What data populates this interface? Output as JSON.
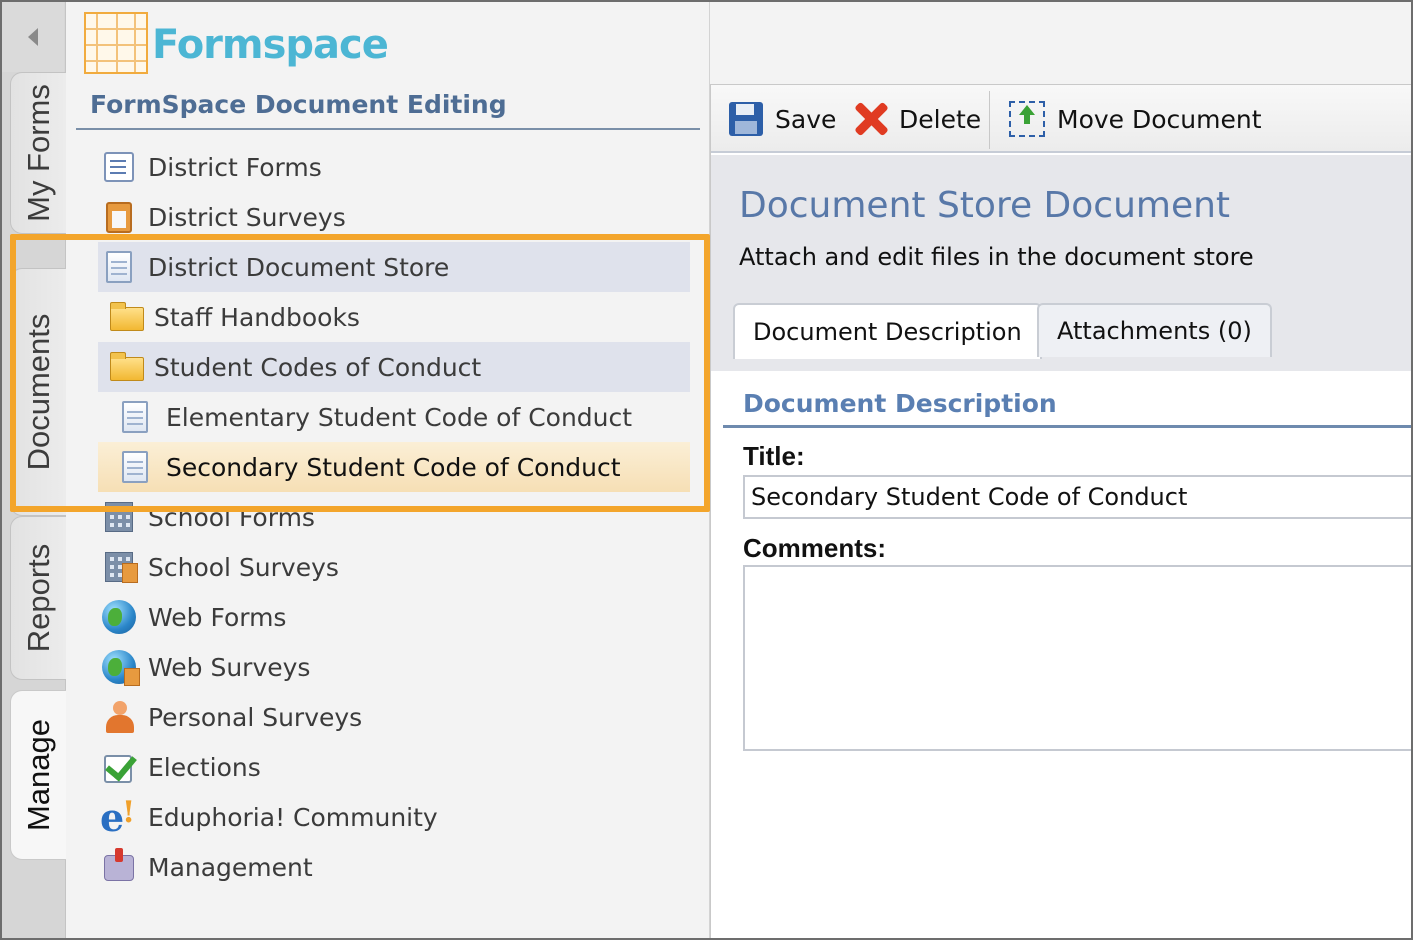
{
  "app": {
    "logo_text": "Formspace",
    "nav_title": "FormSpace Document Editing"
  },
  "vertical_tabs": [
    {
      "label": "My Forms",
      "active": false
    },
    {
      "label": "Documents",
      "active": false
    },
    {
      "label": "Reports",
      "active": false
    },
    {
      "label": "Manage",
      "active": true
    }
  ],
  "tree": [
    {
      "label": "District Forms",
      "icon": "form-icon"
    },
    {
      "label": "District Surveys",
      "icon": "clipboard-icon"
    },
    {
      "label": "District Document Store",
      "icon": "document-icon",
      "selected": "gray"
    },
    {
      "label": "Staff Handbooks",
      "icon": "folder-icon"
    },
    {
      "label": "Student Codes of Conduct",
      "icon": "folder-icon",
      "selected": "gray"
    },
    {
      "label": "Elementary Student Code of Conduct",
      "icon": "document-icon"
    },
    {
      "label": "Secondary Student Code of Conduct",
      "icon": "document-icon",
      "selected": "orange"
    },
    {
      "label": "School Forms",
      "icon": "building-icon"
    },
    {
      "label": "School Surveys",
      "icon": "building-survey-icon"
    },
    {
      "label": "Web Forms",
      "icon": "globe-icon"
    },
    {
      "label": "Web Surveys",
      "icon": "globe-survey-icon"
    },
    {
      "label": "Personal Surveys",
      "icon": "person-icon"
    },
    {
      "label": "Elections",
      "icon": "checkbox-icon"
    },
    {
      "label": "Eduphoria! Community",
      "icon": "eduphoria-icon"
    },
    {
      "label": "Management",
      "icon": "mailbox-icon"
    }
  ],
  "toolbar": {
    "save_label": "Save",
    "delete_label": "Delete",
    "move_label": "Move Document"
  },
  "document": {
    "title": "Document Store Document",
    "subtitle": "Attach and edit files in the document store",
    "tabs": [
      {
        "label": "Document Description",
        "active": true
      },
      {
        "label": "Attachments (0)",
        "active": false
      }
    ],
    "section_title": "Document Description",
    "title_label": "Title:",
    "title_value": "Secondary Student Code of Conduct",
    "comments_label": "Comments:",
    "comments_value": ""
  },
  "colors": {
    "accent_blue": "#5878a8",
    "logo_blue": "#4cb6d4",
    "highlight_orange": "#f3a52b",
    "selected_orange_bg": "#f6dfb5",
    "selected_gray_bg": "#dfe2ec"
  }
}
